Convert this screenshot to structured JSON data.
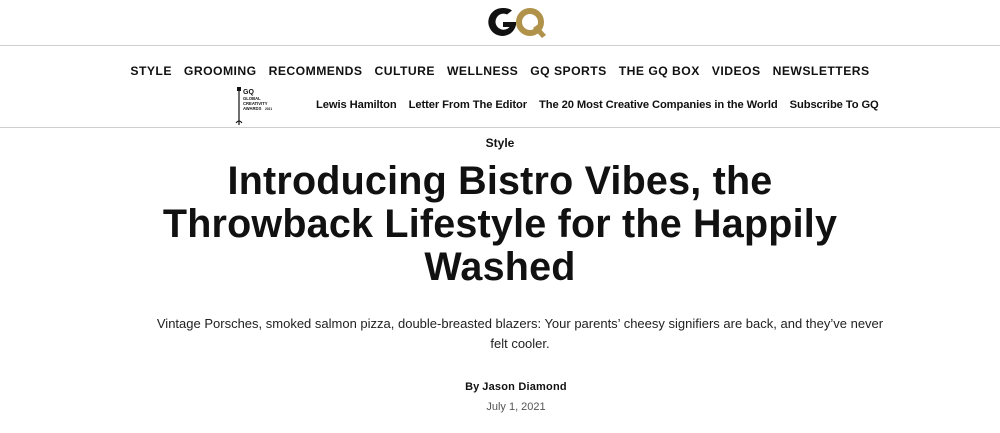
{
  "brand": {
    "logo_text": "GQ",
    "logo_color_g": "#111111",
    "logo_color_q": "#b0924a"
  },
  "main_nav": [
    "STYLE",
    "GROOMING",
    "RECOMMENDS",
    "CULTURE",
    "WELLNESS",
    "GQ SPORTS",
    "THE GQ BOX",
    "VIDEOS",
    "NEWSLETTERS"
  ],
  "badge": {
    "icon": "gq-global-creativity-awards-icon",
    "lines": [
      "GQ",
      "GLOBAL",
      "CREATIVITY",
      "AWARDS",
      "2021"
    ]
  },
  "sub_nav": [
    "Lewis Hamilton",
    "Letter From The Editor",
    "The 20 Most Creative Companies in the World",
    "Subscribe To GQ"
  ],
  "article": {
    "rubric": "Style",
    "headline": "Introducing Bistro Vibes, the Throwback Lifestyle for the Happily Washed",
    "dek": "Vintage Porsches, smoked salmon pizza, double-breasted blazers: Your parents’ cheesy signifiers are back, and they’ve never felt cooler.",
    "byline_prefix": "By",
    "author": "Jason Diamond",
    "date": "July 1, 2021"
  }
}
